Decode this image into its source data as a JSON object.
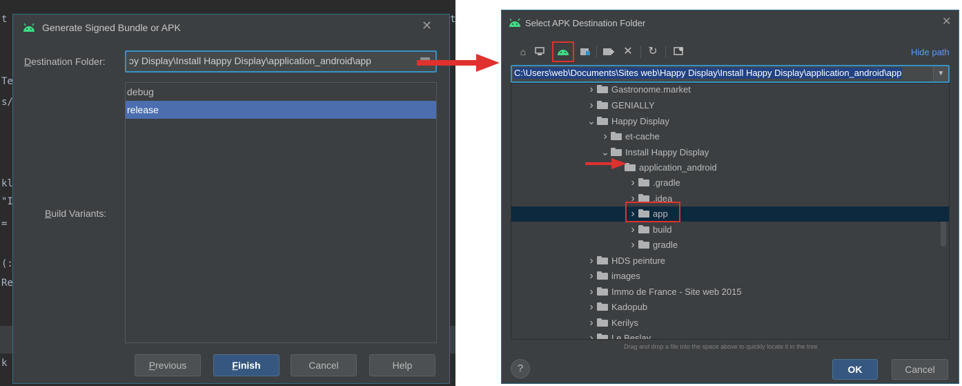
{
  "ide_fragments": [
    "t",
    "Te",
    "s/",
    "kl",
    "\"I",
    "=",
    "(:",
    "Re",
    "k"
  ],
  "ide_fragment_right": "t",
  "left_dialog": {
    "title": "Generate Signed Bundle or APK",
    "destination_label_key": "D",
    "destination_label_rest": "estination Folder:",
    "destination_value": "ɔy Display\\Install Happy Display\\application_android\\app",
    "build_variants_label_key": "B",
    "build_variants_label_rest": "uild Variants:",
    "variants": [
      "debug",
      "release"
    ],
    "selected_variant": "release",
    "buttons": {
      "previous_key": "P",
      "previous_rest": "revious",
      "finish_key": "F",
      "finish_rest": "inish",
      "cancel": "Cancel",
      "help": "Help"
    }
  },
  "right_dialog": {
    "title": "Select APK Destination Folder",
    "hide_path": "Hide path",
    "path_value": "C:\\Users\\web\\Documents\\Sites web\\Happy Display\\Install Happy Display\\application_android\\app",
    "tree": [
      {
        "label": "Gastronome.market",
        "depth": 0,
        "expander": "closed"
      },
      {
        "label": "GENIALLY",
        "depth": 0,
        "expander": "closed"
      },
      {
        "label": "Happy Display",
        "depth": 0,
        "expander": "open"
      },
      {
        "label": "et-cache",
        "depth": 1,
        "expander": "closed"
      },
      {
        "label": "Install Happy Display",
        "depth": 1,
        "expander": "open"
      },
      {
        "label": "application_android",
        "depth": 2,
        "expander": "none"
      },
      {
        "label": ".gradle",
        "depth": 3,
        "expander": "closed"
      },
      {
        "label": ".idea",
        "depth": 3,
        "expander": "closed"
      },
      {
        "label": "app",
        "depth": 3,
        "expander": "closed"
      },
      {
        "label": "build",
        "depth": 3,
        "expander": "closed"
      },
      {
        "label": "gradle",
        "depth": 3,
        "expander": "closed"
      },
      {
        "label": "HDS peinture",
        "depth": 0,
        "expander": "closed"
      },
      {
        "label": "images",
        "depth": 0,
        "expander": "closed"
      },
      {
        "label": "Immo de France - Site web 2015",
        "depth": 0,
        "expander": "closed"
      },
      {
        "label": "Kadopub",
        "depth": 0,
        "expander": "closed"
      },
      {
        "label": "Kerilys",
        "depth": 0,
        "expander": "closed"
      },
      {
        "label": "Le Beslay",
        "depth": 0,
        "expander": "closed"
      }
    ],
    "selected_item": "app",
    "hint": "Drag and drop a file into the space above to quickly locate it in the tree",
    "help_symbol": "?",
    "ok": "OK",
    "cancel": "Cancel"
  },
  "colors": {
    "accent": "#3592c4",
    "selection": "#4b6eaf",
    "tree_selection": "#0d293e",
    "annotation_red": "#e0312e",
    "android_green": "#3ddc84"
  },
  "icons": [
    "android-icon",
    "home-icon",
    "desktop-icon",
    "android-project-icon",
    "module-icon",
    "new-folder-icon",
    "delete-icon",
    "refresh-icon",
    "show-hidden-icon",
    "folder-icon",
    "close-icon",
    "chevron-right-icon",
    "chevron-down-icon",
    "dropdown-icon"
  ]
}
